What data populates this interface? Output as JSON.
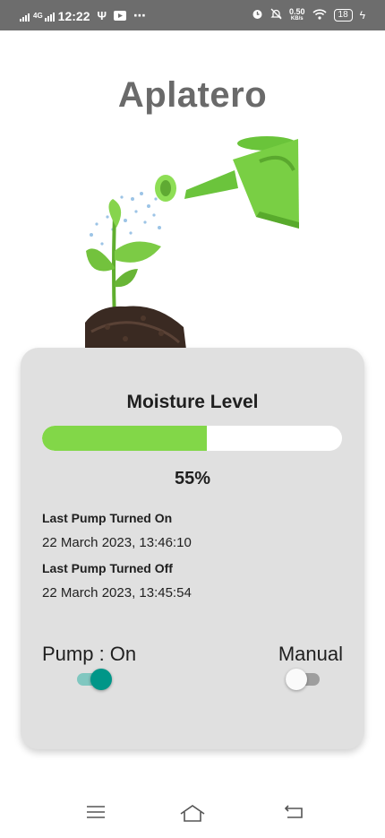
{
  "status_bar": {
    "network": "4G",
    "time": "12:22",
    "speed_value": "0.50",
    "speed_unit": "KB/s",
    "battery": "18",
    "left_icons": [
      "signal-icon",
      "usb-icon",
      "youtube-icon",
      "more-dots-icon"
    ],
    "right_icons": [
      "alarm-icon",
      "mute-icon",
      "wifi-icon",
      "battery-icon",
      "charging-icon"
    ]
  },
  "app": {
    "title": "Aplatero"
  },
  "moisture": {
    "title": "Moisture Level",
    "percent_text": "55%",
    "level_fraction": 0.55,
    "fill_color": "#82d748"
  },
  "pump_history": {
    "on_label": "Last Pump Turned On",
    "on_value": "22 March 2023, 13:46:10",
    "off_label": "Last Pump Turned Off",
    "off_value": "22 March 2023, 13:45:54"
  },
  "controls": {
    "pump_label": "Pump : On",
    "pump_on": true,
    "manual_label": "Manual",
    "manual_on": false,
    "accent_color": "#009688"
  },
  "nav_bar": {
    "icons": [
      "menu-icon",
      "home-icon",
      "back-icon"
    ]
  }
}
